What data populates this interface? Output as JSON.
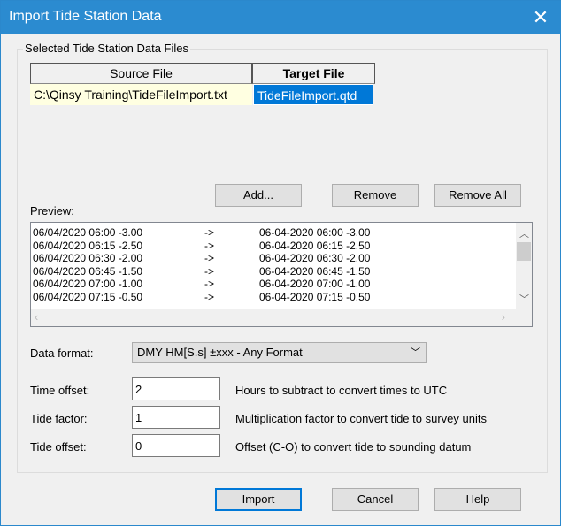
{
  "window": {
    "title": "Import Tide Station Data"
  },
  "group": {
    "label": "Selected Tide Station Data Files"
  },
  "files_table": {
    "headers": [
      "Source File",
      "Target File"
    ],
    "rows": [
      {
        "source": "C:\\Qinsy Training\\TideFileImport.txt",
        "target": "TideFileImport.qtd"
      }
    ]
  },
  "buttons": {
    "add": "Add...",
    "remove": "Remove",
    "remove_all": "Remove All",
    "import": "Import",
    "cancel": "Cancel",
    "help": "Help"
  },
  "preview": {
    "label": "Preview:",
    "rows": [
      {
        "source": "06/04/2020 06:00 -3.00",
        "arrow": "->",
        "target": "06-04-2020 06:00 -3.00"
      },
      {
        "source": "06/04/2020 06:15 -2.50",
        "arrow": "->",
        "target": "06-04-2020 06:15 -2.50"
      },
      {
        "source": "06/04/2020 06:30 -2.00",
        "arrow": "->",
        "target": "06-04-2020 06:30 -2.00"
      },
      {
        "source": "06/04/2020 06:45 -1.50",
        "arrow": "->",
        "target": "06-04-2020 06:45 -1.50"
      },
      {
        "source": "06/04/2020 07:00 -1.00",
        "arrow": "->",
        "target": "06-04-2020 07:00 -1.00"
      },
      {
        "source": "06/04/2020 07:15 -0.50",
        "arrow": "->",
        "target": "06-04-2020 07:15 -0.50"
      }
    ]
  },
  "data_format": {
    "label": "Data format:",
    "value": "DMY HM[S.s] ±xxx - Any Format"
  },
  "time_offset": {
    "label": "Time offset:",
    "value": "2",
    "hint": "Hours to subtract to convert times to UTC"
  },
  "tide_factor": {
    "label": "Tide factor:",
    "value": "1",
    "hint": "Multiplication factor to convert tide to survey units"
  },
  "tide_offset": {
    "label": "Tide offset:",
    "value": "0",
    "hint": "Offset (C-O) to convert tide to sounding datum"
  },
  "colors": {
    "titlebar": "#2b8bd0",
    "selection": "#0078d7",
    "source_cell": "#ffffe1"
  }
}
